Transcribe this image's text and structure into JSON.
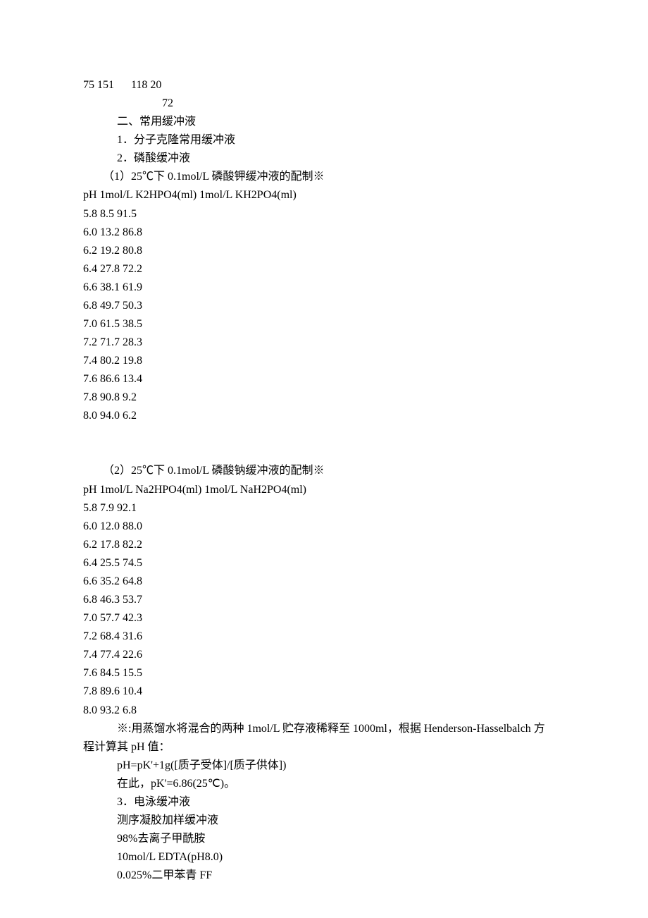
{
  "lines": {
    "l0": "75 151　  118 20",
    "l1": "72",
    "l2": "二、常用缓冲液",
    "l3": "1．分子克隆常用缓冲液",
    "l4": "2．磷酸缓冲液",
    "l5": "（1）25℃下 0.1mol/L 磷酸钾缓冲液的配制※",
    "l6": "pH 1mol/L K2HPO4(ml) 1mol/L KH2PO4(ml)",
    "l7": "5.8 8.5 91.5",
    "l8": "6.0 13.2 86.8",
    "l9": "6.2 19.2 80.8",
    "l10": "6.4 27.8 72.2",
    "l11": "6.6 38.1 61.9",
    "l12": "6.8 49.7 50.3",
    "l13": "7.0 61.5 38.5",
    "l14": "7.2 71.7 28.3",
    "l15": "7.4 80.2 19.8",
    "l16": "7.6 86.6 13.4",
    "l17": "7.8 90.8 9.2",
    "l18": "8.0 94.0 6.2",
    "l19": "（2）25℃下 0.1mol/L 磷酸钠缓冲液的配制※",
    "l20": "pH 1mol/L Na2HPO4(ml) 1mol/L NaH2PO4(ml)",
    "l21": "5.8 7.9 92.1",
    "l22": "6.0 12.0 88.0",
    "l23": "6.2 17.8 82.2",
    "l24": "6.4 25.5 74.5",
    "l25": "6.6 35.2 64.8",
    "l26": "6.8 46.3 53.7",
    "l27": "7.0 57.7 42.3",
    "l28": "7.2 68.4 31.6",
    "l29": "7.4 77.4 22.6",
    "l30": "7.6 84.5 15.5",
    "l31": "7.8 89.6 10.4",
    "l32": "8.0 93.2 6.8",
    "l33a": "※:用蒸馏水将混合的两种 1mol/L 贮存液稀释至 1000ml，根据 Henderson-Hasselbalch 方",
    "l33b": "程计算其 pH 值：",
    "l34": "pH=pK'+1g([质子受体]/[质子供体])",
    "l35": "在此，pK'=6.86(25℃)。",
    "l36": "3．电泳缓冲液",
    "l37": "测序凝胶加样缓冲液",
    "l38": "98%去离子甲酰胺",
    "l39": "10mol/L EDTA(pH8.0)",
    "l40": "0.025%二甲苯青 FF"
  },
  "chart_data": [
    {
      "type": "table",
      "title": "25℃下 0.1mol/L 磷酸钾缓冲液的配制",
      "columns": [
        "pH",
        "1mol/L K2HPO4(ml)",
        "1mol/L KH2PO4(ml)"
      ],
      "rows": [
        [
          5.8,
          8.5,
          91.5
        ],
        [
          6.0,
          13.2,
          86.8
        ],
        [
          6.2,
          19.2,
          80.8
        ],
        [
          6.4,
          27.8,
          72.2
        ],
        [
          6.6,
          38.1,
          61.9
        ],
        [
          6.8,
          49.7,
          50.3
        ],
        [
          7.0,
          61.5,
          38.5
        ],
        [
          7.2,
          71.7,
          28.3
        ],
        [
          7.4,
          80.2,
          19.8
        ],
        [
          7.6,
          86.6,
          13.4
        ],
        [
          7.8,
          90.8,
          9.2
        ],
        [
          8.0,
          94.0,
          6.2
        ]
      ]
    },
    {
      "type": "table",
      "title": "25℃下 0.1mol/L 磷酸钠缓冲液的配制",
      "columns": [
        "pH",
        "1mol/L Na2HPO4(ml)",
        "1mol/L NaH2PO4(ml)"
      ],
      "rows": [
        [
          5.8,
          7.9,
          92.1
        ],
        [
          6.0,
          12.0,
          88.0
        ],
        [
          6.2,
          17.8,
          82.2
        ],
        [
          6.4,
          25.5,
          74.5
        ],
        [
          6.6,
          35.2,
          64.8
        ],
        [
          6.8,
          46.3,
          53.7
        ],
        [
          7.0,
          57.7,
          42.3
        ],
        [
          7.2,
          68.4,
          31.6
        ],
        [
          7.4,
          77.4,
          22.6
        ],
        [
          7.6,
          84.5,
          15.5
        ],
        [
          7.8,
          89.6,
          10.4
        ],
        [
          8.0,
          93.2,
          6.8
        ]
      ]
    }
  ]
}
